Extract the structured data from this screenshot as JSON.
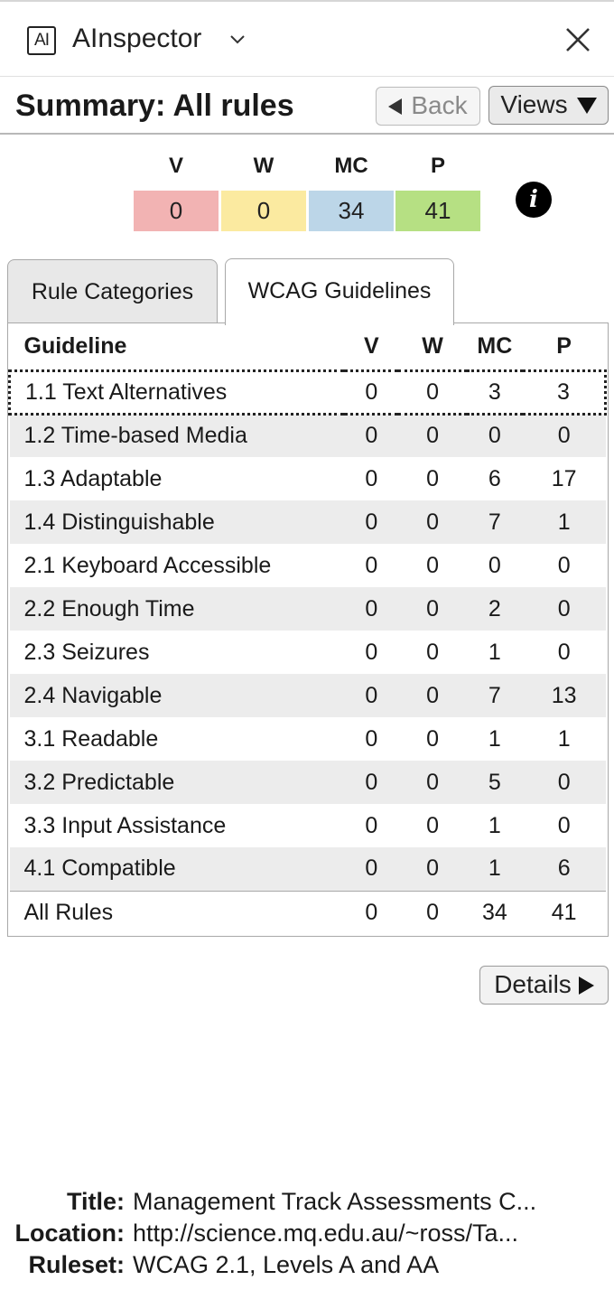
{
  "sidebar": {
    "icon_text": "AI",
    "title": "AInspector"
  },
  "toolbar": {
    "title": "Summary: All rules",
    "back_label": "Back",
    "views_label": "Views"
  },
  "summary": {
    "labels": [
      "V",
      "W",
      "MC",
      "P"
    ],
    "values": [
      "0",
      "0",
      "34",
      "41"
    ],
    "colors": [
      "#f2b3b3",
      "#fbeaa0",
      "#bcd6e8",
      "#b6e083"
    ],
    "info_glyph": "i"
  },
  "tabs": [
    {
      "label": "Rule Categories",
      "selected": false
    },
    {
      "label": "WCAG Guidelines",
      "selected": true
    }
  ],
  "table": {
    "headers": [
      "Guideline",
      "V",
      "W",
      "MC",
      "P"
    ],
    "rows": [
      {
        "name": "1.1 Text Alternatives",
        "v": "0",
        "w": "0",
        "mc": "3",
        "p": "3"
      },
      {
        "name": "1.2 Time-based Media",
        "v": "0",
        "w": "0",
        "mc": "0",
        "p": "0"
      },
      {
        "name": "1.3 Adaptable",
        "v": "0",
        "w": "0",
        "mc": "6",
        "p": "17"
      },
      {
        "name": "1.4 Distinguishable",
        "v": "0",
        "w": "0",
        "mc": "7",
        "p": "1"
      },
      {
        "name": "2.1 Keyboard Accessible",
        "v": "0",
        "w": "0",
        "mc": "0",
        "p": "0"
      },
      {
        "name": "2.2 Enough Time",
        "v": "0",
        "w": "0",
        "mc": "2",
        "p": "0"
      },
      {
        "name": "2.3 Seizures",
        "v": "0",
        "w": "0",
        "mc": "1",
        "p": "0"
      },
      {
        "name": "2.4 Navigable",
        "v": "0",
        "w": "0",
        "mc": "7",
        "p": "13"
      },
      {
        "name": "3.1 Readable",
        "v": "0",
        "w": "0",
        "mc": "1",
        "p": "1"
      },
      {
        "name": "3.2 Predictable",
        "v": "0",
        "w": "0",
        "mc": "5",
        "p": "0"
      },
      {
        "name": "3.3 Input Assistance",
        "v": "0",
        "w": "0",
        "mc": "1",
        "p": "0"
      },
      {
        "name": "4.1 Compatible",
        "v": "0",
        "w": "0",
        "mc": "1",
        "p": "6"
      }
    ],
    "total": {
      "name": "All Rules",
      "v": "0",
      "w": "0",
      "mc": "34",
      "p": "41"
    },
    "selected_row": 0
  },
  "details_label": "Details",
  "footer": {
    "title_key": "Title:",
    "title_value": "Management Track Assessments C...",
    "location_key": "Location:",
    "location_value": "http://science.mq.edu.au/~ross/Ta...",
    "ruleset_key": "Ruleset:",
    "ruleset_value": "WCAG 2.1, Levels A and AA"
  }
}
